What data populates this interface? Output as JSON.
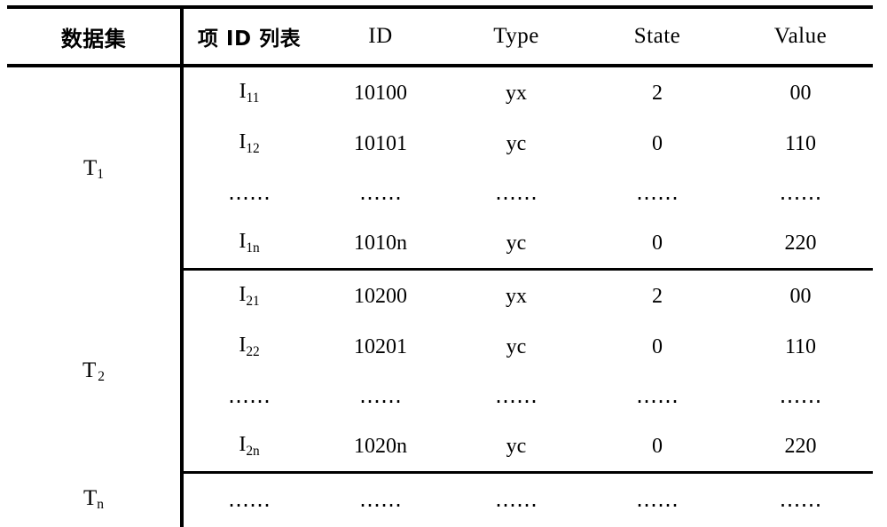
{
  "table": {
    "columns": [
      {
        "key": "dataset",
        "label": "数据集"
      },
      {
        "key": "items",
        "label": "项 ID 列表"
      },
      {
        "key": "id",
        "label": "ID"
      },
      {
        "key": "type",
        "label": "Type"
      },
      {
        "key": "state",
        "label": "State"
      },
      {
        "key": "value",
        "label": "Value"
      }
    ],
    "ellipsis": "……",
    "blocks": [
      {
        "dataset_base": "T",
        "dataset_sub": "1",
        "rows": [
          {
            "item_base": "I",
            "item_sub": "11",
            "id": "10100",
            "type": "yx",
            "state": "2",
            "value": "00"
          },
          {
            "item_base": "I",
            "item_sub": "12",
            "id": "10101",
            "type": "yc",
            "state": "0",
            "value": "110"
          },
          {
            "item_base": "……",
            "item_sub": "",
            "id": "……",
            "type": "……",
            "state": "……",
            "value": "……"
          },
          {
            "item_base": "I",
            "item_sub": "1n",
            "id": "1010n",
            "type": "yc",
            "state": "0",
            "value": "220"
          }
        ]
      },
      {
        "dataset_base": "T",
        "dataset_sub": "2",
        "rows": [
          {
            "item_base": "I",
            "item_sub": "21",
            "id": "10200",
            "type": "yx",
            "state": "2",
            "value": "00"
          },
          {
            "item_base": "I",
            "item_sub": "22",
            "id": "10201",
            "type": "yc",
            "state": "0",
            "value": "110"
          },
          {
            "item_base": "……",
            "item_sub": "",
            "id": "……",
            "type": "……",
            "state": "……",
            "value": "……"
          },
          {
            "item_base": "I",
            "item_sub": "2n",
            "id": "1020n",
            "type": "yc",
            "state": "0",
            "value": "220"
          }
        ]
      },
      {
        "dataset_base": "T",
        "dataset_sub": "n",
        "rows": [
          {
            "item_base": "……",
            "item_sub": "",
            "id": "……",
            "type": "……",
            "state": "……",
            "value": "……"
          }
        ]
      }
    ]
  },
  "colors": {
    "rule": "#000000",
    "text": "#000000",
    "background": "#ffffff"
  }
}
